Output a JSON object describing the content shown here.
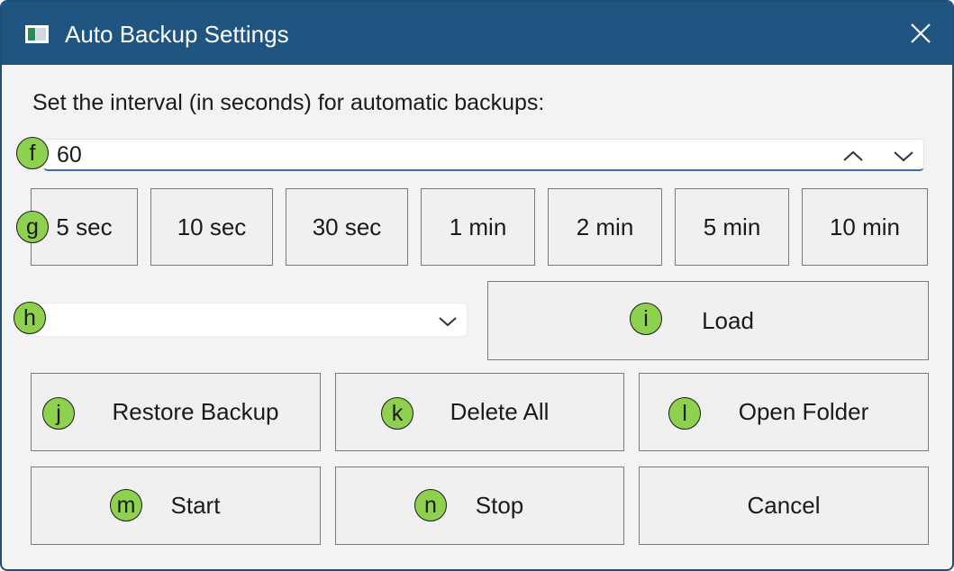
{
  "window": {
    "title": "Auto Backup Settings",
    "app_icon": "window-app-icon",
    "close_icon": "close-icon"
  },
  "colors": {
    "titlebar": "#1f5580",
    "input_underline": "#3b6ea5",
    "marker_fill": "#8dd14f",
    "button_border": "#7a7a7a"
  },
  "interval": {
    "prompt": "Set the interval (in seconds) for automatic backups:",
    "value": "60",
    "spin_up_icon": "chevron-up-icon",
    "spin_down_icon": "chevron-down-icon"
  },
  "presets": [
    "5 sec",
    "10 sec",
    "30 sec",
    "1 min",
    "2 min",
    "5 min",
    "10 min"
  ],
  "backup_select": {
    "value": "",
    "chevron_icon": "chevron-down-icon"
  },
  "actions": {
    "load": "Load",
    "restore": "Restore Backup",
    "delete_all": "Delete All",
    "open_folder": "Open Folder",
    "start": "Start",
    "stop": "Stop",
    "cancel": "Cancel"
  },
  "markers": {
    "f": "f",
    "g": "g",
    "h": "h",
    "i": "i",
    "j": "j",
    "k": "k",
    "l": "l",
    "m": "m",
    "n": "n"
  }
}
